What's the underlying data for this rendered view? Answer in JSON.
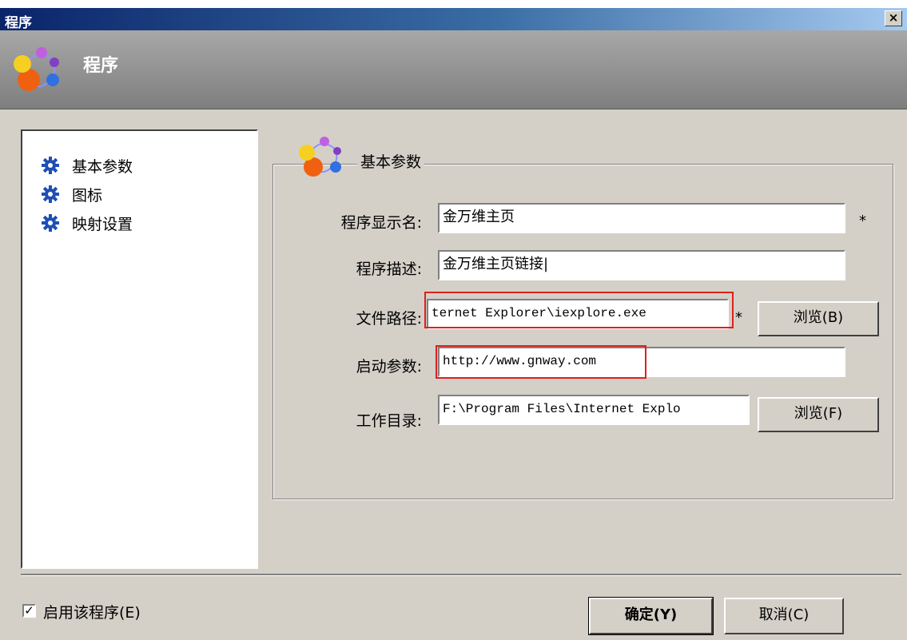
{
  "window": {
    "title": "程序",
    "close_glyph": "×"
  },
  "header": {
    "title": "程序",
    "icon": "molecule-icon"
  },
  "nav": {
    "items": [
      {
        "label": "基本参数",
        "icon": "gear-icon"
      },
      {
        "label": "图标",
        "icon": "gear-icon"
      },
      {
        "label": "映射设置",
        "icon": "gear-icon"
      }
    ]
  },
  "group": {
    "title": "基本参数",
    "icon": "molecule-icon"
  },
  "form": {
    "display_name": {
      "label": "程序显示名:",
      "value": "金万维主页",
      "required": "*"
    },
    "description": {
      "label": "程序描述:",
      "value": "金万维主页链接|"
    },
    "file_path": {
      "label": "文件路径:",
      "value": "ternet Explorer\\iexplore.exe",
      "required": "*",
      "browse": "浏览(B)"
    },
    "start_args": {
      "label": "启动参数:",
      "value": "http://www.gnway.com"
    },
    "work_dir": {
      "label": "工作目录:",
      "value": "F:\\Program Files\\Internet Explo",
      "browse": "浏览(F)"
    }
  },
  "footer": {
    "enable_label": "启用该程序(E)",
    "enable_checked": "✓",
    "ok": "确定(Y)",
    "cancel": "取消(C)"
  },
  "colors": {
    "highlight": "#e0201c",
    "title_start": "#0a246a",
    "title_end": "#a6caf0"
  }
}
